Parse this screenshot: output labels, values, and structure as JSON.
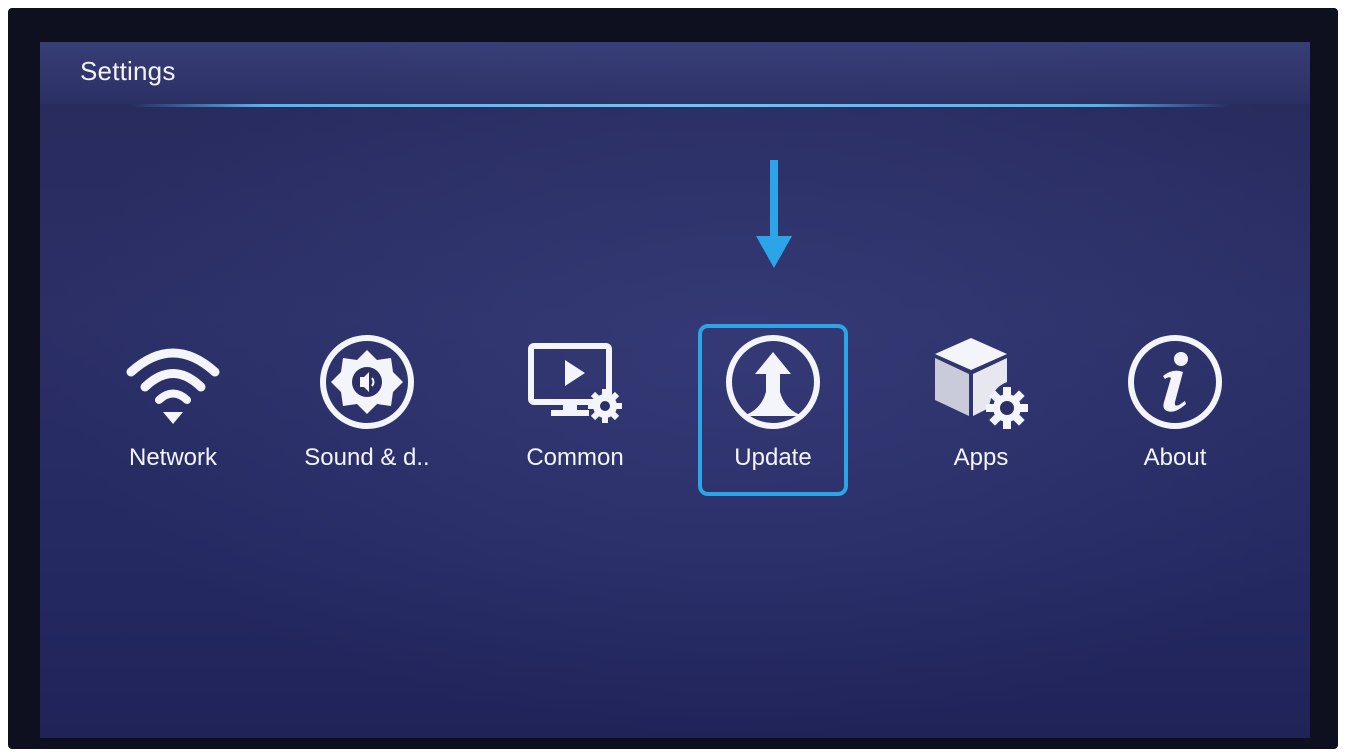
{
  "header": {
    "title": "Settings"
  },
  "menu": {
    "items": [
      {
        "label": "Network",
        "icon": "wifi-icon"
      },
      {
        "label": "Sound & d..",
        "icon": "sound-icon"
      },
      {
        "label": "Common",
        "icon": "monitor-gear-icon"
      },
      {
        "label": "Update",
        "icon": "upload-arrow-icon",
        "selected": true
      },
      {
        "label": "Apps",
        "icon": "cube-gear-icon"
      },
      {
        "label": "About",
        "icon": "info-icon"
      }
    ]
  },
  "colors": {
    "accent": "#2ba4e8",
    "background": "#2b2f66",
    "text": "#f4f5fa"
  }
}
